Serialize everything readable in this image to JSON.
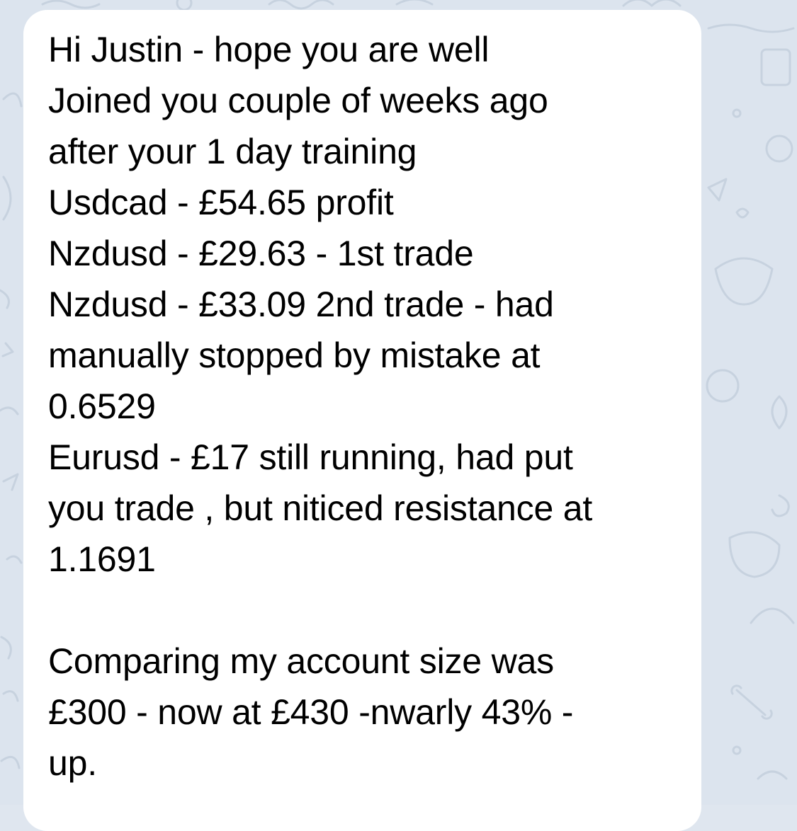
{
  "chat": {
    "background_color": "#dce4ee",
    "bubble_color": "#ffffff",
    "text_color": "#000000"
  },
  "message": {
    "lines": [
      "Hi Justin - hope you are well",
      "Joined you couple of weeks ago",
      "after your 1 day training",
      "Usdcad - £54.65 profit",
      "Nzdusd - £29.63 - 1st trade",
      "Nzdusd - £33.09 2nd trade - had",
      "manually stopped by mistake at",
      "0.6529",
      "Eurusd - £17 still running, had put",
      "you trade , but niticed resistance at",
      "1.1691",
      "",
      "Comparing my account size was",
      "£300 - now at £430 -nwarly 43% -",
      "up."
    ]
  }
}
